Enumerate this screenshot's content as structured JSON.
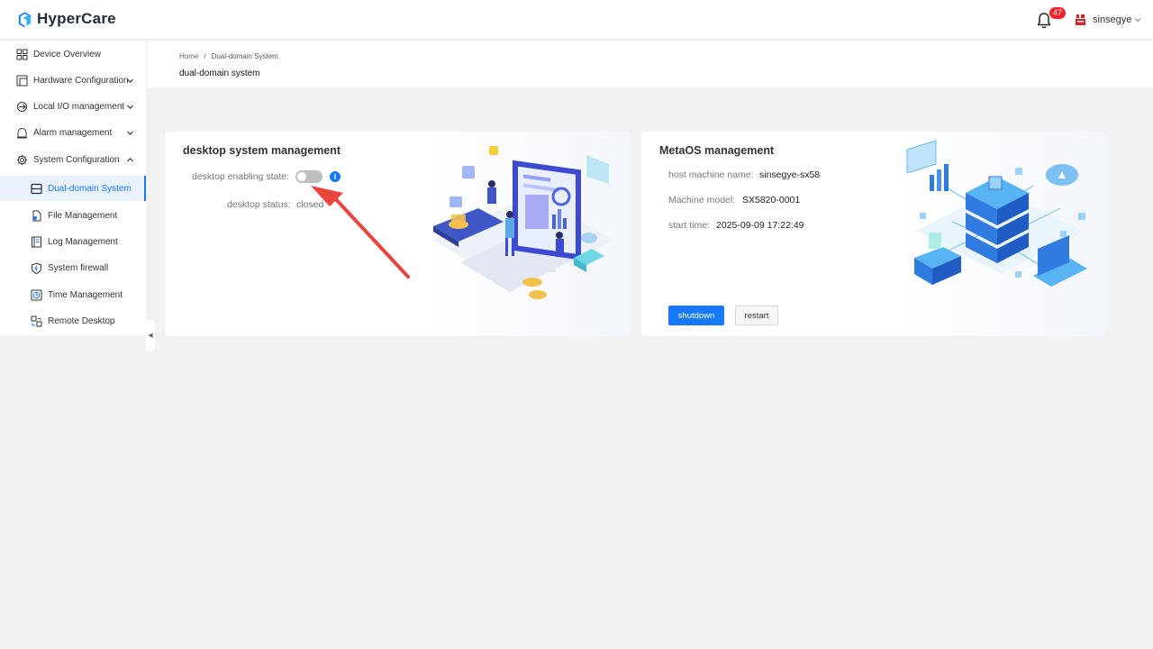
{
  "app": {
    "name": "HyperCare",
    "notification_count": "47",
    "username": "sinsegye"
  },
  "sidebar": {
    "items": [
      {
        "label": "Device Overview",
        "icon": "grid-icon",
        "expandable": false
      },
      {
        "label": "Hardware Configuration",
        "icon": "hardware-icon",
        "expandable": true,
        "expanded": false
      },
      {
        "label": "Local I/O management",
        "icon": "io-icon",
        "expandable": true,
        "expanded": false
      },
      {
        "label": "Alarm management",
        "icon": "alarm-icon",
        "expandable": true,
        "expanded": false
      },
      {
        "label": "System Configuration",
        "icon": "gear-icon",
        "expandable": true,
        "expanded": true
      },
      {
        "label": "Dual-domain System",
        "icon": "dual-domain-icon",
        "active": true
      },
      {
        "label": "File Management",
        "icon": "file-icon"
      },
      {
        "label": "Log Management",
        "icon": "log-icon"
      },
      {
        "label": "System firewall",
        "icon": "shield-icon"
      },
      {
        "label": "Time Management",
        "icon": "clock-icon"
      },
      {
        "label": "Remote Desktop",
        "icon": "remote-desktop-icon"
      }
    ]
  },
  "breadcrumb": [
    "Home",
    "Dual-domain System"
  ],
  "breadcrumb_separator": "/",
  "page_title": "dual-domain system",
  "desktop_card": {
    "title": "desktop system management",
    "enabling_label": "desktop enabling state:",
    "enabled": false,
    "info_glyph": "i",
    "status_label": "desktop status:",
    "status_value": "closed"
  },
  "metaos_card": {
    "title": "MetaOS management",
    "fields": [
      {
        "label": "host machine name:",
        "value": "sinsegye-sx58"
      },
      {
        "label": "Machine model:",
        "value": "SX5820-0001"
      },
      {
        "label": "start time:",
        "value": "2025-09-09 17:22:49"
      }
    ],
    "shutdown_label": "shutdown",
    "restart_label": "restart"
  },
  "collapse_glyph": "◀",
  "colors": {
    "primary": "#1677ff",
    "badge": "#f5222d",
    "annotation_arrow": "#e8453c",
    "background": "#f2f2f2"
  }
}
